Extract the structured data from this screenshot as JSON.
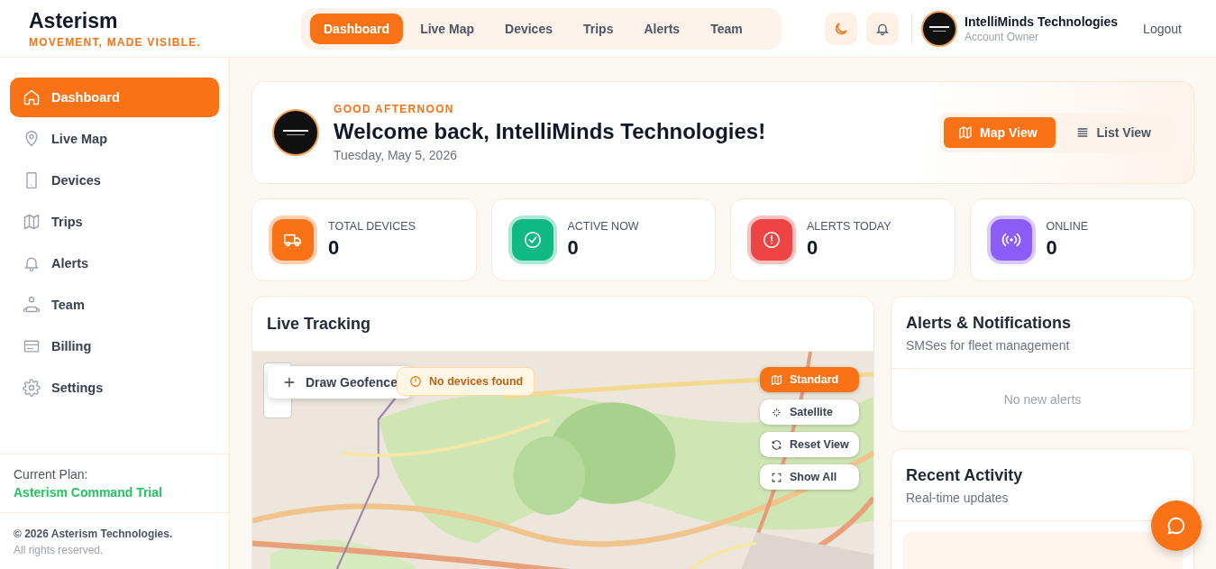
{
  "brand": {
    "name": "Asterism",
    "tagline": "MOVEMENT, MADE VISIBLE."
  },
  "nav": [
    {
      "label": "Dashboard",
      "selected": true
    },
    {
      "label": "Live Map",
      "selected": false
    },
    {
      "label": "Devices",
      "selected": false
    },
    {
      "label": "Trips",
      "selected": false
    },
    {
      "label": "Alerts",
      "selected": false
    },
    {
      "label": "Team",
      "selected": false
    }
  ],
  "user": {
    "name": "IntelliMinds Technologies",
    "role": "Account Owner"
  },
  "logout": "Logout",
  "sidebar": {
    "items": [
      {
        "label": "Dashboard",
        "kind": "home",
        "selected": true
      },
      {
        "label": "Live Map",
        "kind": "pin",
        "selected": false
      },
      {
        "label": "Devices",
        "kind": "phone",
        "selected": false
      },
      {
        "label": "Trips",
        "kind": "map",
        "selected": false
      },
      {
        "label": "Alerts",
        "kind": "bell",
        "selected": false
      },
      {
        "label": "Team",
        "kind": "team",
        "selected": false
      },
      {
        "label": "Billing",
        "kind": "card",
        "selected": false
      },
      {
        "label": "Settings",
        "kind": "gear",
        "selected": false
      }
    ],
    "plan_label": "Current Plan:",
    "plan": "Asterism Command Trial",
    "copyright": "© 2026 Asterism Technologies.",
    "rights": "All rights reserved."
  },
  "welcome": {
    "greeting": "GOOD AFTERNOON",
    "title": "Welcome back, IntelliMinds Technologies!",
    "date": "Tuesday, May 5, 2026",
    "views": [
      {
        "label": "Map View",
        "kind": "map",
        "selected": true
      },
      {
        "label": "List View",
        "kind": "list",
        "selected": false
      }
    ]
  },
  "stats": [
    {
      "label": "TOTAL DEVICES",
      "value": "0",
      "kind": "truck",
      "color": "#f97316"
    },
    {
      "label": "ACTIVE NOW",
      "value": "0",
      "kind": "check",
      "color": "#10b981"
    },
    {
      "label": "ALERTS TODAY",
      "value": "0",
      "kind": "alert",
      "color": "#ef4444"
    },
    {
      "label": "ONLINE",
      "value": "0",
      "kind": "signal",
      "color": "#8b5cf6"
    }
  ],
  "live_tracking": {
    "title": "Live Tracking",
    "geofence": "Draw Geofence",
    "status": "No devices found",
    "layers": [
      {
        "label": "Standard",
        "kind": "map",
        "selected": true
      },
      {
        "label": "Satellite",
        "kind": "satellite",
        "selected": false
      }
    ],
    "actions": [
      {
        "label": "Reset View",
        "kind": "reset"
      },
      {
        "label": "Show All",
        "kind": "expand"
      }
    ]
  },
  "alerts": {
    "title": "Alerts & Notifications",
    "subtitle": "SMSes for fleet management",
    "empty": "No new alerts"
  },
  "activity": {
    "title": "Recent Activity",
    "subtitle": "Real-time updates"
  }
}
